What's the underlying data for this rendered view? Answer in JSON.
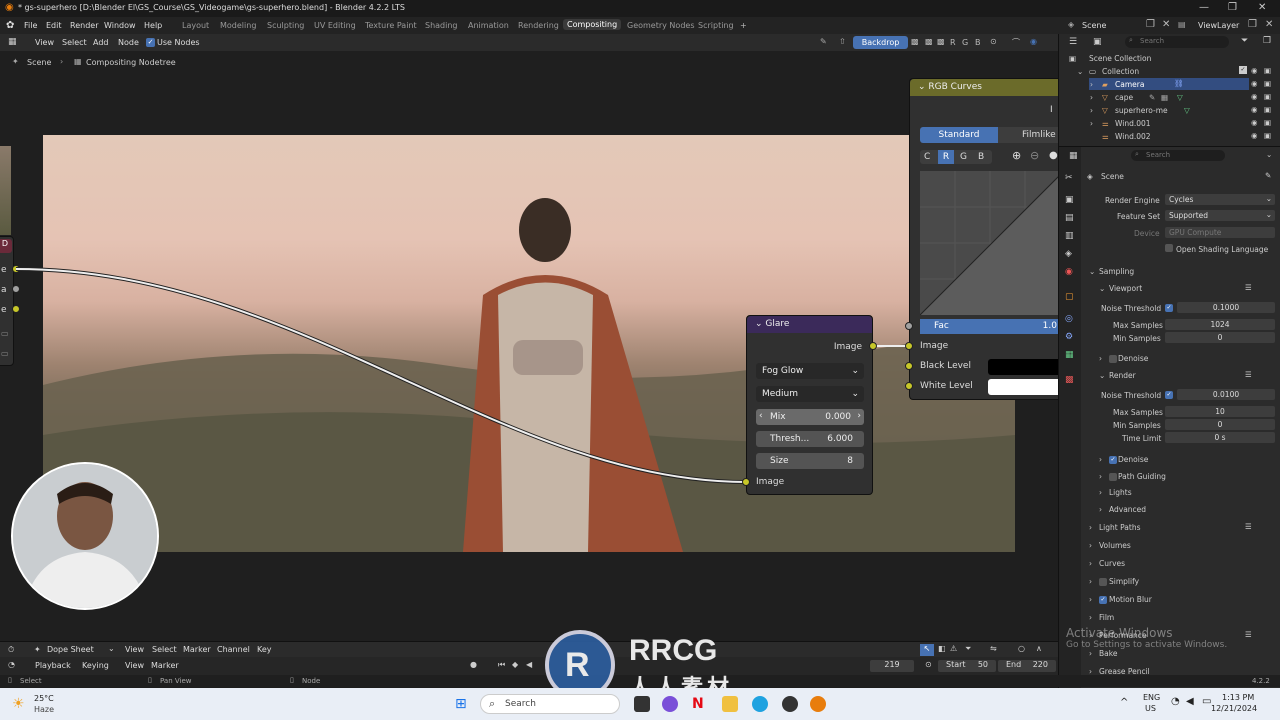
{
  "window": {
    "title": "* gs-superhero [D:\\Blender El\\GS_Course\\GS_Videogame\\gs-superhero.blend] - Blender 4.2.2 LTS"
  },
  "menus": [
    "File",
    "Edit",
    "Render",
    "Window",
    "Help"
  ],
  "workspaces": [
    "Layout",
    "Modeling",
    "Sculpting",
    "UV Editing",
    "Texture Paint",
    "Shading",
    "Animation",
    "Rendering",
    "Compositing",
    "Geometry Nodes",
    "Scripting",
    "+"
  ],
  "active_workspace": "Compositing",
  "scene_selector": {
    "scene": "Scene",
    "view_layer": "ViewLayer"
  },
  "node_editor": {
    "menus": [
      "View",
      "Select",
      "Add",
      "Node"
    ],
    "use_nodes_label": "Use Nodes",
    "backdrop_label": "Backdrop",
    "channel_labels": [
      "R",
      "G",
      "B"
    ],
    "breadcrumb": [
      "Scene",
      "Compositing Nodetree"
    ]
  },
  "glare_node": {
    "title": "Glare",
    "output_label": "Image",
    "type": "Fog Glow",
    "quality": "Medium",
    "mix_label": "Mix",
    "mix_value": "0.000",
    "threshold_label": "Thresh...",
    "threshold_value": "6.000",
    "size_label": "Size",
    "size_value": "8",
    "input_label": "Image"
  },
  "curves_node": {
    "title": "RGB Curves",
    "corner_text": "I",
    "tab_standard": "Standard",
    "tab_filmlike": "Filmlike",
    "channels": [
      "C",
      "R",
      "G",
      "B"
    ],
    "fac_label": "Fac",
    "fac_value": "1.0",
    "image_label": "Image",
    "black_level_label": "Black Level",
    "white_level_label": "White Level"
  },
  "left_node_sockets": [
    "e",
    "a",
    "e"
  ],
  "outliner": {
    "search_placeholder": "Search",
    "items": [
      {
        "label": "Scene Collection"
      },
      {
        "label": "Collection"
      },
      {
        "label": "Camera"
      },
      {
        "label": "cape"
      },
      {
        "label": "superhero-me"
      },
      {
        "label": "Wind.001"
      },
      {
        "label": "Wind.002"
      }
    ]
  },
  "properties": {
    "search_placeholder": "Search",
    "context": "Scene",
    "render_engine_label": "Render Engine",
    "render_engine": "Cycles",
    "feature_set_label": "Feature Set",
    "feature_set": "Supported",
    "device_label": "Device",
    "device": "GPU Compute",
    "osl_label": "Open Shading Language",
    "sampling": "Sampling",
    "viewport": "Viewport",
    "noise_threshold_label": "Noise Threshold",
    "vp_noise_threshold": "0.1000",
    "max_samples_label": "Max Samples",
    "vp_max_samples": "1024",
    "min_samples_label": "Min Samples",
    "vp_min_samples": "0",
    "denoise_label": "Denoise",
    "render": "Render",
    "r_noise_threshold": "0.0100",
    "r_max_samples": "10",
    "r_min_samples": "0",
    "time_limit_label": "Time Limit",
    "r_time_limit": "0 s",
    "path_guiding": "Path Guiding",
    "lights": "Lights",
    "advanced": "Advanced",
    "light_paths": "Light Paths",
    "volumes": "Volumes",
    "curves": "Curves",
    "simplify": "Simplify",
    "motion_blur": "Motion Blur",
    "film": "Film",
    "performance": "Performance",
    "bake": "Bake",
    "grease_pencil": "Grease Pencil"
  },
  "dope_sheet": {
    "mode": "Dope Sheet",
    "menus": [
      "View",
      "Select",
      "Marker",
      "Channel",
      "Key"
    ]
  },
  "timeline": {
    "menus": [
      "Playback",
      "Keying",
      "View",
      "Marker"
    ],
    "current_frame": "219",
    "start_label": "Start",
    "start": "50",
    "end_label": "End",
    "end": "220"
  },
  "status_bar": {
    "select": "Select",
    "pan": "Pan View",
    "node": "Node",
    "version": "4.2.2"
  },
  "activation": {
    "line1": "Activate Windows",
    "line2": "Go to Settings to activate Windows."
  },
  "taskbar": {
    "weather_temp": "25°C",
    "weather_desc": "Haze",
    "search_placeholder": "Search",
    "lang": "ENG",
    "region": "US",
    "time": "1:13 PM",
    "date": "12/21/2024"
  },
  "watermark": {
    "brand": "RRCG",
    "sub": "人人素材"
  }
}
